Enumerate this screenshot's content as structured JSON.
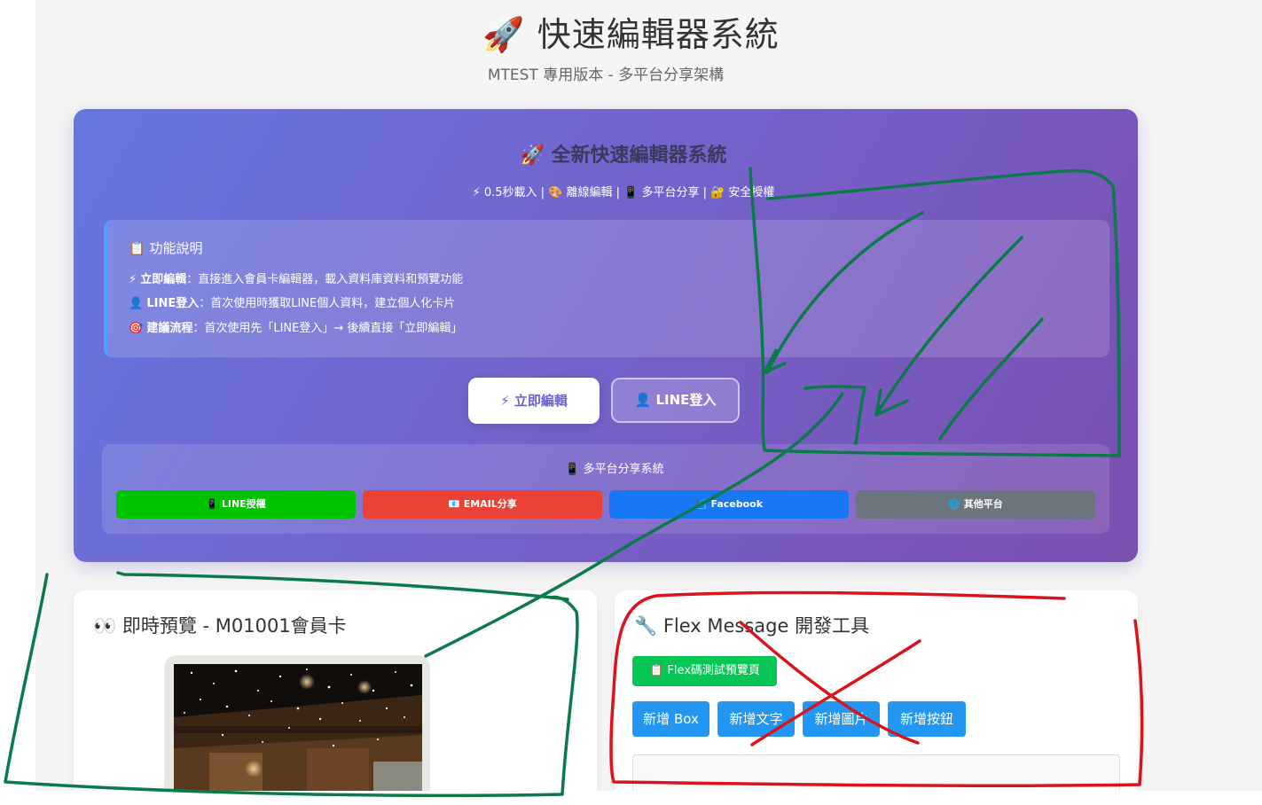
{
  "page": {
    "title_icon": "🚀",
    "title": "快速編輯器系統",
    "subtitle": "MTEST 專用版本 - 多平台分享架構"
  },
  "hero": {
    "title": "🚀 全新快速編輯器系統",
    "features": "⚡ 0.5秒載入 | 🎨 離線編輯 | 📱 多平台分享 | 🔐 安全授權",
    "info": {
      "title": "📋 功能說明",
      "rows": [
        {
          "icon": "⚡",
          "label": "立即編輯",
          "text": "：直接進入會員卡編輯器，載入資料庫資料和預覽功能"
        },
        {
          "icon": "👤",
          "label": "LINE登入",
          "text": "：首次使用時獲取LINE個人資料，建立個人化卡片"
        },
        {
          "icon": "🎯",
          "label": "建議流程",
          "text": "：首次使用先「LINE登入」→ 後續直接「立即編輯」"
        }
      ]
    },
    "buttons": {
      "edit": "⚡ 立即編輯",
      "line_login": "👤 LINE登入"
    },
    "share": {
      "title": "📱 多平台分享系統",
      "buttons": [
        {
          "label": "📱 LINE授權",
          "color": "#00c300"
        },
        {
          "label": "📧 EMAIL分享",
          "color": "#ea4335"
        },
        {
          "label": "📘 Facebook",
          "color": "#1877f2"
        },
        {
          "label": "🌐 其他平台",
          "color": "#6c757d"
        }
      ]
    }
  },
  "preview": {
    "title": "👀 即時預覽 - M01001會員卡"
  },
  "flex_tools": {
    "title": "🔧 Flex Message 開發工具",
    "test_button": "📋 Flex碼測試預覽頁",
    "add_buttons": [
      "新增 Box",
      "新增文字",
      "新增圖片",
      "新增按鈕"
    ]
  },
  "colors": {
    "hero_start": "#6677e0",
    "hero_end": "#7a4fb0",
    "line_green": "#06c755",
    "add_blue": "#2196f3",
    "annotation_green": "#0b7a4a",
    "annotation_red": "#d9141c"
  }
}
